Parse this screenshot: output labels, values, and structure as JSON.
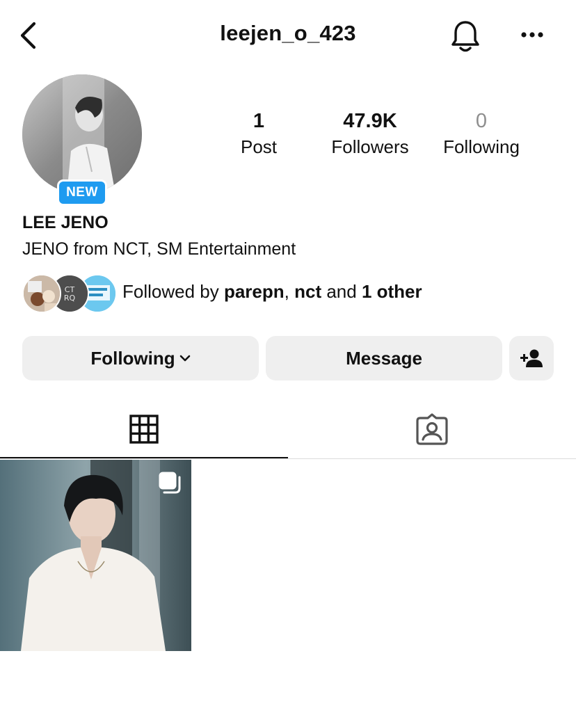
{
  "header": {
    "username": "leejen_o_423",
    "back_icon": "chevron-left-icon",
    "bell_icon": "bell-icon",
    "more_icon": "more-horizontal-icon"
  },
  "profile": {
    "new_badge": "NEW",
    "full_name": "LEE JENO",
    "bio": "JENO from NCT, SM Entertainment"
  },
  "stats": {
    "posts": {
      "value": "1",
      "label": "Post"
    },
    "followers": {
      "value": "47.9K",
      "label": "Followers"
    },
    "following": {
      "value": "0",
      "label": "Following"
    }
  },
  "mutuals": {
    "prefix": "Followed by ",
    "user1": "parepn",
    "sep": ", ",
    "user2": "nct",
    "and": " and ",
    "others": "1 other"
  },
  "actions": {
    "following_label": "Following",
    "message_label": "Message",
    "add_user_icon": "add-person-icon"
  },
  "tabs": {
    "grid_icon": "grid-icon",
    "tagged_icon": "tagged-person-icon",
    "active": "grid"
  },
  "colors": {
    "accent_blue": "#1e9bf0",
    "button_bg": "#efefef",
    "muted_text": "#8e8e8e"
  }
}
